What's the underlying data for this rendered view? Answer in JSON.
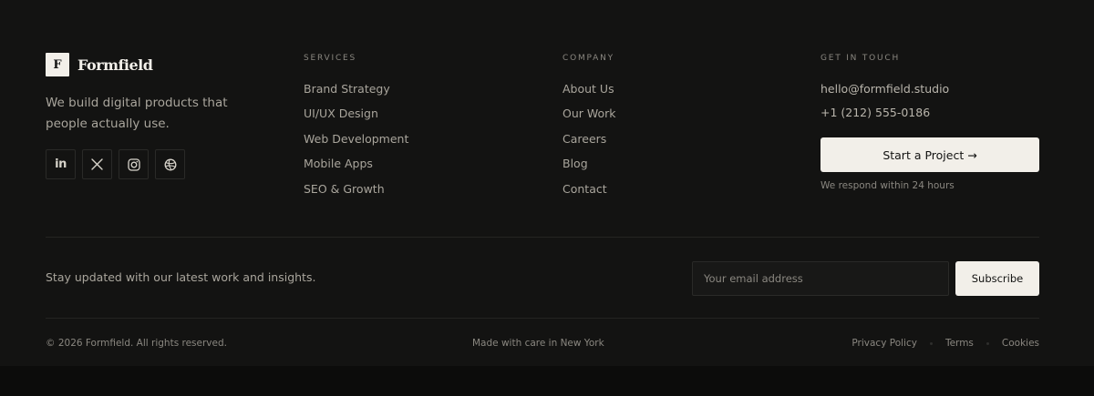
{
  "brand": {
    "logo_letter": "F",
    "name": "Formfield",
    "tagline": "We build digital products that people actually use.",
    "socials": [
      {
        "icon": "linkedin-icon",
        "glyph": "in"
      },
      {
        "icon": "x-icon"
      },
      {
        "icon": "instagram-icon"
      },
      {
        "icon": "globe-icon"
      }
    ]
  },
  "services": {
    "title": "SERVICES",
    "items": [
      "Brand Strategy",
      "UI/UX Design",
      "Web Development",
      "Mobile Apps",
      "SEO & Growth"
    ]
  },
  "company": {
    "title": "COMPANY",
    "items": [
      "About Us",
      "Our Work",
      "Careers",
      "Blog",
      "Contact"
    ]
  },
  "contact": {
    "title": "GET IN TOUCH",
    "email": "hello@formfield.studio",
    "phone": "+1 (212) 555-0186",
    "cta_label": "Start a Project →",
    "respond_note": "We respond within 24 hours"
  },
  "newsletter": {
    "text": "Stay updated with our latest work and insights.",
    "placeholder": "Your email address",
    "button_label": "Subscribe"
  },
  "bottom": {
    "copyright": "© 2026 Formfield. All rights reserved.",
    "made_with": "Made with care in New York",
    "links": [
      "Privacy Policy",
      "Terms",
      "Cookies"
    ]
  },
  "colors": {
    "background": "#131312",
    "page_background": "#0c0c0b",
    "accent_button": "#f2efe9",
    "text": "#a9a59c",
    "muted": "#8a8780"
  }
}
